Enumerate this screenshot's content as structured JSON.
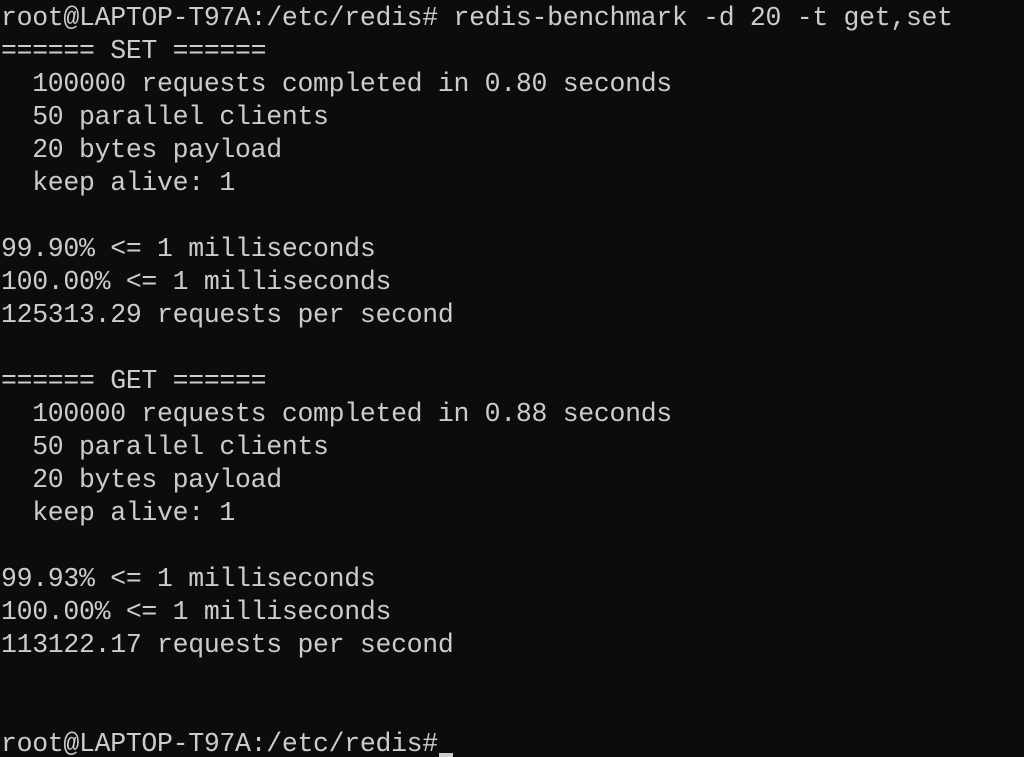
{
  "terminal": {
    "lines": [
      "root@LAPTOP-T97A:/etc/redis# redis-benchmark -d 20 -t get,set",
      "====== SET ======",
      "  100000 requests completed in 0.80 seconds",
      "  50 parallel clients",
      "  20 bytes payload",
      "  keep alive: 1",
      "",
      "99.90% <= 1 milliseconds",
      "100.00% <= 1 milliseconds",
      "125313.29 requests per second",
      "",
      "====== GET ======",
      "  100000 requests completed in 0.88 seconds",
      "  50 parallel clients",
      "  20 bytes payload",
      "  keep alive: 1",
      "",
      "99.93% <= 1 milliseconds",
      "100.00% <= 1 milliseconds",
      "113122.17 requests per second",
      "",
      "",
      "root@LAPTOP-T97A:/etc/redis#"
    ]
  }
}
